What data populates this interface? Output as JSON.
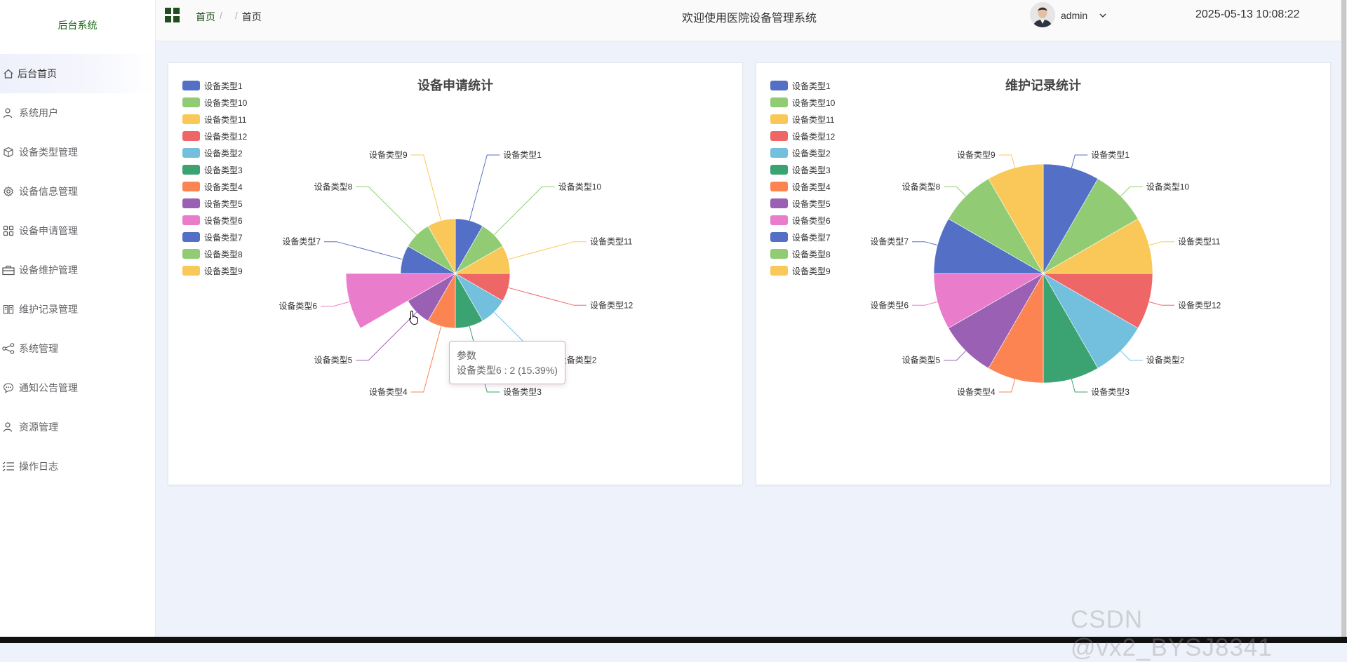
{
  "sidebar": {
    "brand": "后台系统",
    "items": [
      {
        "label": "后台首页",
        "icon": "home-icon",
        "active": true
      },
      {
        "label": "系统用户",
        "icon": "user-icon"
      },
      {
        "label": "设备类型管理",
        "icon": "box-icon"
      },
      {
        "label": "设备信息管理",
        "icon": "gear-icon"
      },
      {
        "label": "设备申请管理",
        "icon": "grid-icon"
      },
      {
        "label": "设备维护管理",
        "icon": "toolbox-icon"
      },
      {
        "label": "维护记录管理",
        "icon": "book-icon"
      },
      {
        "label": "系统管理",
        "icon": "share-icon"
      },
      {
        "label": "通知公告管理",
        "icon": "chat-icon"
      },
      {
        "label": "资源管理",
        "icon": "users-icon"
      },
      {
        "label": "操作日志",
        "icon": "list-icon"
      }
    ]
  },
  "header": {
    "breadcrumb": [
      "首页",
      "/",
      "/",
      "首页"
    ],
    "welcome": "欢迎使用医院设备管理系统",
    "username": "admin",
    "datetime": "2025-05-13 10:08:22"
  },
  "colors": {
    "accent": "#1e4d1e",
    "palette": [
      "#5470c6",
      "#91cc75",
      "#fac858",
      "#ee6666",
      "#73c0de",
      "#3ba272",
      "#fc8452",
      "#9a60b4",
      "#ea7ccc",
      "#5470c6",
      "#91cc75",
      "#fac858"
    ]
  },
  "chart_data": [
    {
      "type": "pie",
      "subtype": "rose",
      "title": "设备申请统计",
      "legend_position": "top-left",
      "categories": [
        "设备类型1",
        "设备类型10",
        "设备类型11",
        "设备类型12",
        "设备类型2",
        "设备类型3",
        "设备类型4",
        "设备类型5",
        "设备类型6",
        "设备类型7",
        "设备类型8",
        "设备类型9"
      ],
      "values": [
        1,
        1,
        1,
        1,
        1,
        1,
        1,
        1,
        2,
        1,
        1,
        1
      ],
      "highlighted": "设备类型6",
      "tooltip": {
        "title": "参数",
        "text": "设备类型6 : 2 (15.39%)"
      }
    },
    {
      "type": "pie",
      "title": "维护记录统计",
      "legend_position": "top-left",
      "categories": [
        "设备类型1",
        "设备类型10",
        "设备类型11",
        "设备类型12",
        "设备类型2",
        "设备类型3",
        "设备类型4",
        "设备类型5",
        "设备类型6",
        "设备类型7",
        "设备类型8",
        "设备类型9"
      ],
      "values": [
        1,
        1,
        1,
        1,
        1,
        1,
        1,
        1,
        1,
        1,
        1,
        1
      ]
    }
  ],
  "watermark": "CSDN @vx2_BYSJ8341"
}
